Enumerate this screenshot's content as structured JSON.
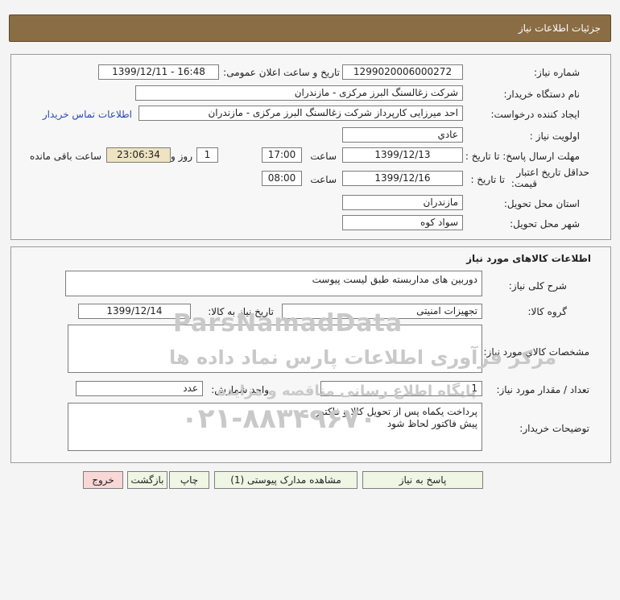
{
  "header": {
    "title": "جزئیات اطلاعات نیاز"
  },
  "details": {
    "need_number_label": "شماره نیاز:",
    "need_number": "1299020006000272",
    "announce_label": "تاریخ و ساعت اعلان عمومی:",
    "announce_value": "1399/12/11 - 16:48",
    "buyer_org_label": "نام دستگاه خریدار:",
    "buyer_org": "شرکت زغالسنگ البرز مرکزی - مازندران",
    "creator_label": "ایجاد کننده درخواست:",
    "creator": "احد میرزایی کارپرداز شرکت زغالسنگ البرز مرکزی - مازندران",
    "contact_link": "اطلاعات تماس خریدار",
    "priority_label": "اولویت نیاز :",
    "priority": "عادي",
    "deadline_label": "مهلت ارسال پاسخ: تا تاریخ :",
    "deadline_date": "1399/12/13",
    "time_label": "ساعت",
    "deadline_time": "17:00",
    "days_value": "1",
    "days_label": "روز و",
    "remaining_time": "23:06:34",
    "remaining_label": "ساعت باقی مانده",
    "validity_label_1": "حداقل تاریخ اعتبار",
    "validity_label_2": "قیمت:",
    "validity_to_label": "تا تاریخ :",
    "validity_date": "1399/12/16",
    "validity_time_label": "ساعت",
    "validity_time": "08:00",
    "province_label": "استان محل تحویل:",
    "province": "مازندران",
    "city_label": "شهر محل تحویل:",
    "city": "سواد کوه"
  },
  "goods": {
    "section_title": "اطلاعات کالاهای مورد نیاز",
    "summary_label": "شرح کلی نیاز:",
    "summary": "دوربین های مداربسته طبق لیست پیوست",
    "group_label": "گروه کالا:",
    "group": "تجهیزات امنیتی",
    "need_date_label": "تاریخ نیاز به کالا:",
    "need_date": "1399/12/14",
    "specs_label": "مشخصات کالاي مورد نیاز:",
    "specs": "",
    "qty_label": "تعداد / مقدار مورد نیاز:",
    "qty": "1",
    "unit_label": "واحد شمارش:",
    "unit": "عدد",
    "buyer_notes_label": "توضیحات خریدار:",
    "buyer_notes_1": "پرداخت یکماه پس از تحویل کالا و فاکتور",
    "buyer_notes_2": "پیش فاکتور لحاظ شود"
  },
  "buttons": {
    "respond": "پاسخ به نیاز",
    "attachments": "مشاهده مدارک پیوستی (1)",
    "print": "چاپ",
    "back": "بازگشت",
    "exit": "خروج"
  },
  "watermark": {
    "brand": "ParsNamadData",
    "tagline": "مرکز فرآوری اطلاعات پارس نماد داده ها",
    "sub": "پایگاه اطلاع رسانی مناقصه و مزایده",
    "phone": "۰۲۱-۸۸۳۴۹۶۷۰"
  },
  "colors": {
    "header_bg": "#8a6d44",
    "button_bg": "#f0f5e4",
    "exit_bg": "#f9d7d7",
    "remaining_bg": "#eee4c2",
    "link": "#2a49b8"
  }
}
